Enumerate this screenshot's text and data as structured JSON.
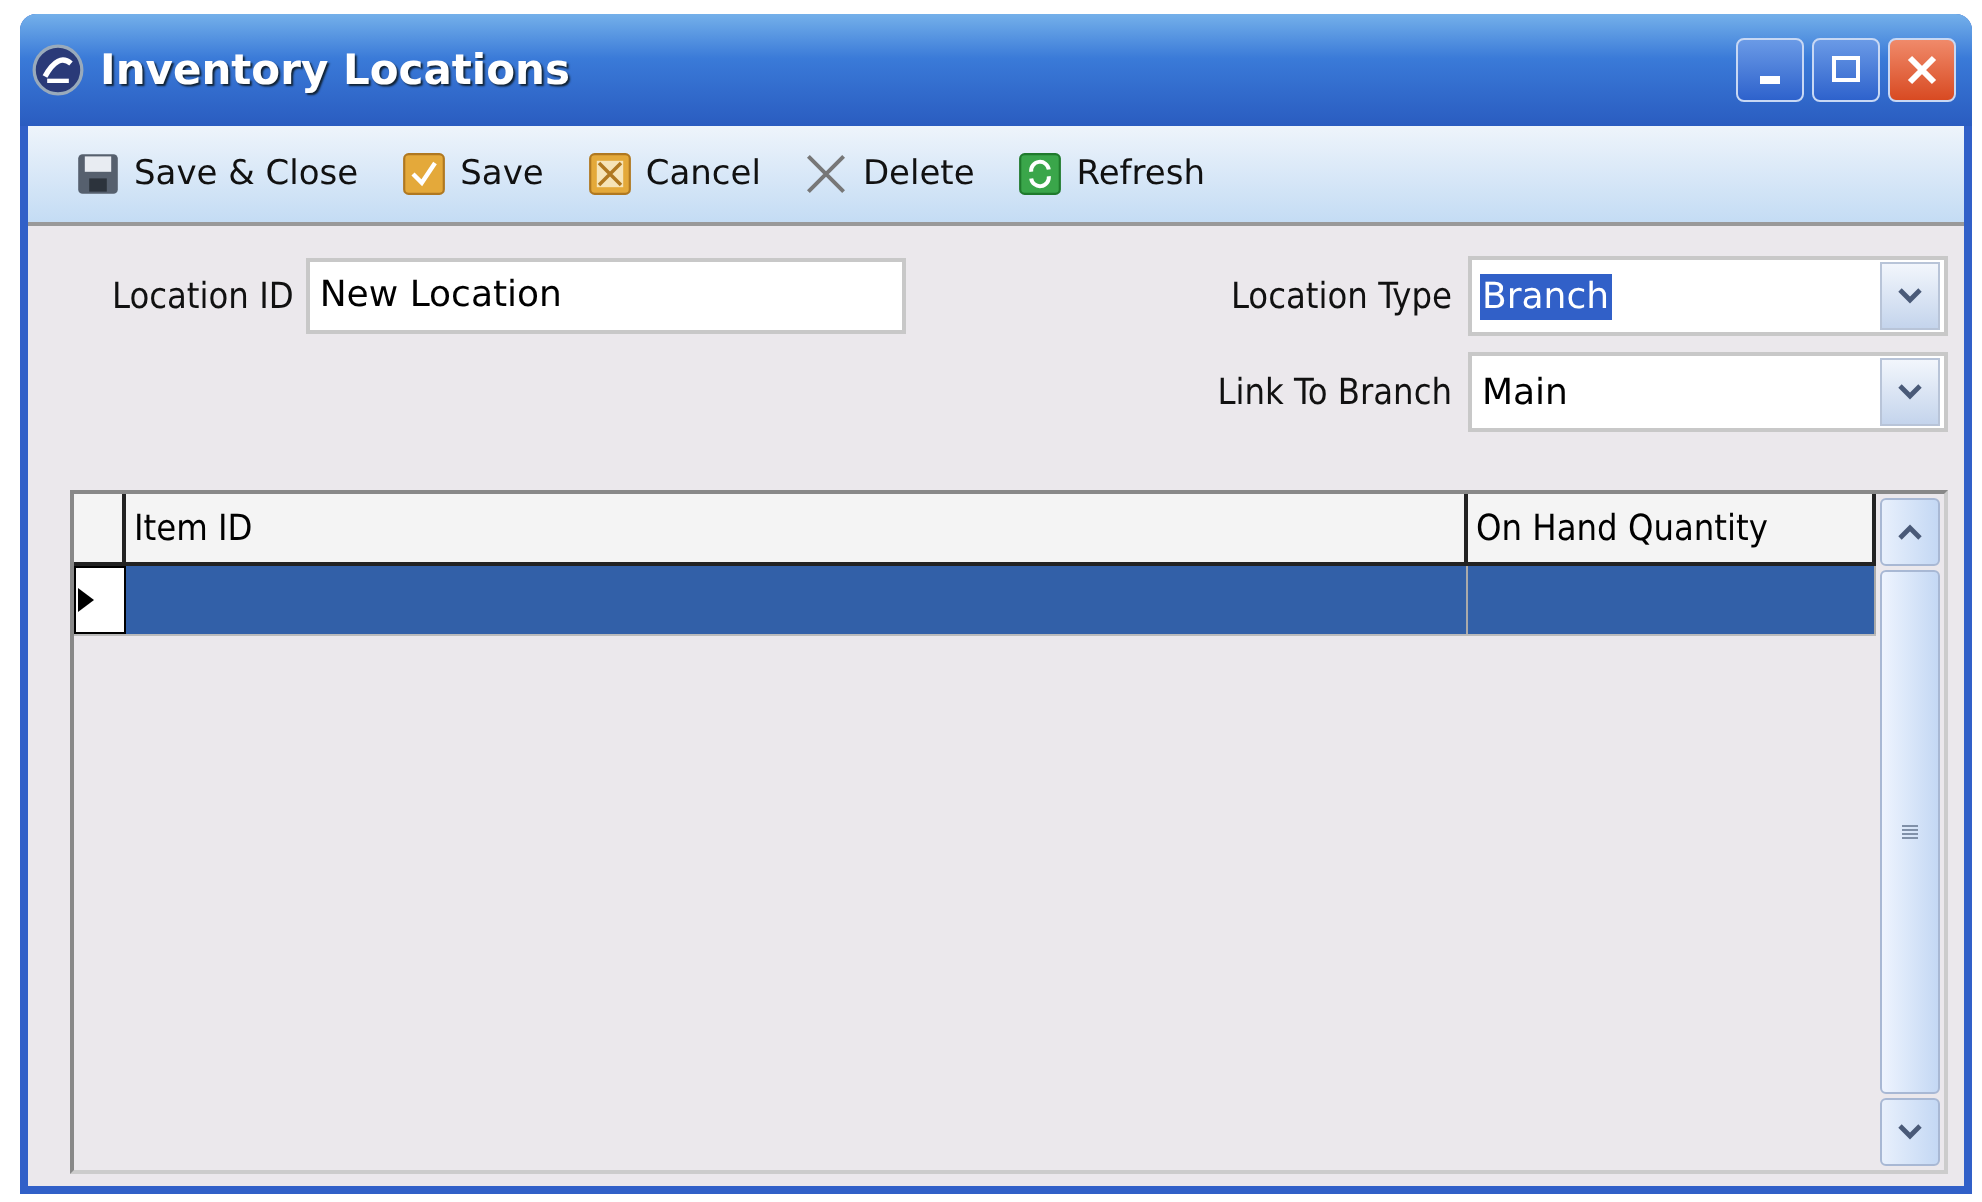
{
  "window": {
    "title": "Inventory Locations"
  },
  "toolbar": [
    {
      "label": "Save & Close",
      "kind": "floppy"
    },
    {
      "label": "Save",
      "kind": "check"
    },
    {
      "label": "Cancel",
      "kind": "cancel"
    },
    {
      "label": "Delete",
      "kind": "delete"
    },
    {
      "label": "Refresh",
      "kind": "refresh"
    }
  ],
  "form": {
    "location_id": {
      "label": "Location ID",
      "value": "New Location"
    },
    "location_type": {
      "label": "Location Type",
      "value": "Branch",
      "highlighted": true
    },
    "link_to_branch": {
      "label": "Link To Branch",
      "value": "Main",
      "highlighted": false
    }
  },
  "grid": {
    "columns": [
      "Item ID",
      "On Hand Quantity"
    ],
    "rows": [
      {
        "selected": true
      }
    ]
  }
}
